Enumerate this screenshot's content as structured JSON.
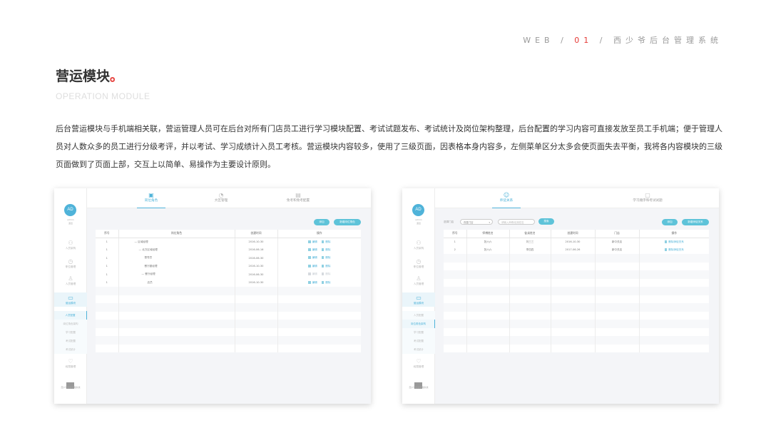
{
  "header": {
    "breadcrumb_prefix": "WEB / ",
    "breadcrumb_num": "01",
    "breadcrumb_suffix": " / 西少爷后台管理系统"
  },
  "title": {
    "text": "营运模块",
    "dot": "。"
  },
  "subtitle": "OPERATION MODULE",
  "description": "后台营运模块与手机端相关联，营运管理人员可在后台对所有门店员工进行学习模块配置、考试试题发布、考试统计及岗位架构整理，后台配置的学习内容可直接发放至员工手机端；便于管理人员对人数众多的员工进行分级考评，并以考试、学习成绩计入员工考核。营运模块内容较多，使用了三级页面，因表格本身内容多，左侧菜单区分太多会使页面失去平衡，我将各内容模块的三级页面做到了页面上部，交互上以简单、易操作为主要设计原则。",
  "sidebar": {
    "avatar": "AD",
    "user_name": "admin",
    "user_role": "退出",
    "items": [
      "人员架构",
      "职位管理",
      "人员管理",
      "营运模块",
      "权限管理"
    ],
    "sub_items": [
      "人员配置",
      "岗位角色架构",
      "学习配置",
      "考试配置",
      "考试统计"
    ],
    "footer": "西少爷后台管理系统"
  },
  "left_panel": {
    "tabs": [
      "岗位角色",
      "大区管理",
      "免考和免考配置"
    ],
    "buttons": [
      "添加",
      "新增岗位角色"
    ],
    "table": {
      "headers": [
        "序号",
        "岗位角色",
        "创建时间",
        "操作"
      ],
      "rows": [
        {
          "id": "1",
          "name": "— 区域经理",
          "date": "2016-10-30"
        },
        {
          "id": "1",
          "name": "— 北方区域经理",
          "date": "2016-06-16"
        },
        {
          "id": "1",
          "name": "督导员",
          "date": "2016-06-30"
        },
        {
          "id": "1",
          "name": "餐厅副经理",
          "date": "2016-10-30"
        },
        {
          "id": "1",
          "name": "— 餐厅经理",
          "date": "2016-06-30"
        },
        {
          "id": "1",
          "name": "店员",
          "date": "2016-10-30"
        }
      ],
      "op_edit": "编辑",
      "op_delete": "删除"
    }
  },
  "right_panel": {
    "tabs": [
      "师徒关系",
      "学习顺序和考试试题"
    ],
    "filter_label": "选择门店",
    "filter_select": "西直门店",
    "search_placeholder": "请输入师傅/徒弟姓名",
    "search_button": "搜索",
    "buttons": [
      "添加",
      "新增师徒关系"
    ],
    "table": {
      "headers": [
        "序号",
        "师傅姓名",
        "徒弟姓名",
        "创建时间",
        "门店",
        "操作"
      ],
      "rows": [
        {
          "id": "1",
          "master": "张六六",
          "apprentice": "刘三三",
          "date": "2016-10-30",
          "store": "新中关店"
        },
        {
          "id": "2",
          "master": "张六六",
          "apprentice": "李四四",
          "date": "2017-06-26",
          "store": "新中关店"
        }
      ],
      "op_delete": "删除师徒关系"
    }
  }
}
